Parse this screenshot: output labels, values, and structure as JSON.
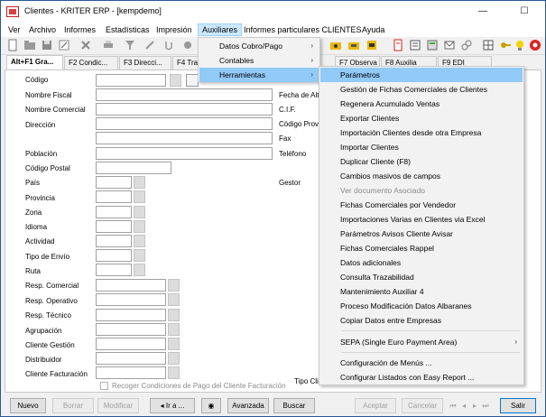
{
  "window": {
    "title": "Clientes - KRITER ERP - [kempdemo]",
    "controls": {
      "minimize": "—",
      "maximize": "☐",
      "close": "✕"
    }
  },
  "menubar": [
    "Ver",
    "Archivo",
    "Informes",
    "Estadísticas",
    "Impresión",
    "Auxiliares",
    "Informes particulares CLIENTES",
    "Ayuda"
  ],
  "active_menu": "Auxiliares",
  "tabs": [
    "Alt+F1 Gra...",
    "F2 Condic...",
    "F3 Direcci...",
    "F4 Tra",
    "F7 Observa",
    "F8 Auxilia",
    "F9 EDI"
  ],
  "form": {
    "labels": {
      "codigo": "Código",
      "nombre_fiscal": "Nombre Fiscal",
      "nombre_comercial": "Nombre Comercial",
      "direccion": "Dirección",
      "poblacion": "Población",
      "codigo_postal": "Código Postal",
      "pais": "País",
      "provincia": "Provincia",
      "zona": "Zona",
      "idioma": "Idioma",
      "actividad": "Actividad",
      "tipo_envio": "Tipo de Envío",
      "ruta": "Ruta",
      "resp_comercial": "Resp. Comercial",
      "resp_operativo": "Resp. Operativo",
      "resp_tecnico": "Resp. Técnico",
      "agrupacion": "Agrupación",
      "cliente_gestion": "Cliente Gestión",
      "distribuidor": "Distribuidor",
      "cliente_facturacion": "Cliente Facturación",
      "fecha_alta": "Fecha de Alt",
      "cif": "C.I.F.",
      "codigo_postal_right": "Código Prov",
      "fax": "Fax",
      "telefono": "Teléfono",
      "gestor": "Gestor",
      "tipo_cli": "Tipo Cli"
    },
    "checkbox_recoger": "Recoger Condiciones de Pago del Cliente Facturación"
  },
  "bottom_buttons": {
    "nuevo": "Nuevo",
    "borrar": "Borrar",
    "modificar": "Modificar",
    "ir_a": "Ir a ...",
    "avanzada": "Avanzada",
    "buscar": "Buscar",
    "aceptar": "Aceptar",
    "cancelar": "Cancelar",
    "salir": "Salir"
  },
  "auxiliares_menu": [
    {
      "label": "Datos Cobro/Pago",
      "submenu": true
    },
    {
      "label": "Contables",
      "submenu": true
    },
    {
      "label": "Herramientas",
      "submenu": true,
      "selected": true
    }
  ],
  "herramientas_menu": [
    {
      "label": "Parámetros",
      "selected": true
    },
    {
      "label": "Gestión de Fichas Comerciales de Clientes"
    },
    {
      "label": "Regenera Acumulado Ventas"
    },
    {
      "label": "Exportar Clientes"
    },
    {
      "label": "Importación Clientes desde otra Empresa"
    },
    {
      "label": "Importar Clientes"
    },
    {
      "label": "Duplicar Cliente (F8)"
    },
    {
      "label": "Cambios masivos de campos"
    },
    {
      "label": "Ver documento Asociado",
      "disabled": true
    },
    {
      "label": "Fichas Comerciales por Vendedor"
    },
    {
      "label": "Importaciones Varias en Clientes via Excel"
    },
    {
      "label": "Parámetros Avisos Cliente Avisar"
    },
    {
      "label": "Fichas Comerciales Rappel"
    },
    {
      "label": "Datos adicionales"
    },
    {
      "label": "Consulta Trazabilidad"
    },
    {
      "label": "Mantenimiento Auxiliar 4"
    },
    {
      "label": "Proceso Modificación Datos Albaranes"
    },
    {
      "label": "Copiar Datos entre Empresas"
    },
    {
      "label": "SEPA (Single Euro Payment Area)",
      "submenu": true
    },
    {
      "label": "Configuración de Menús ..."
    },
    {
      "label": "Configurar Listados con Easy Report ..."
    }
  ],
  "colors": {
    "selection": "#91c9f7",
    "menu_active": "#cce8ff",
    "menu_bg": "#f2f2f2"
  }
}
